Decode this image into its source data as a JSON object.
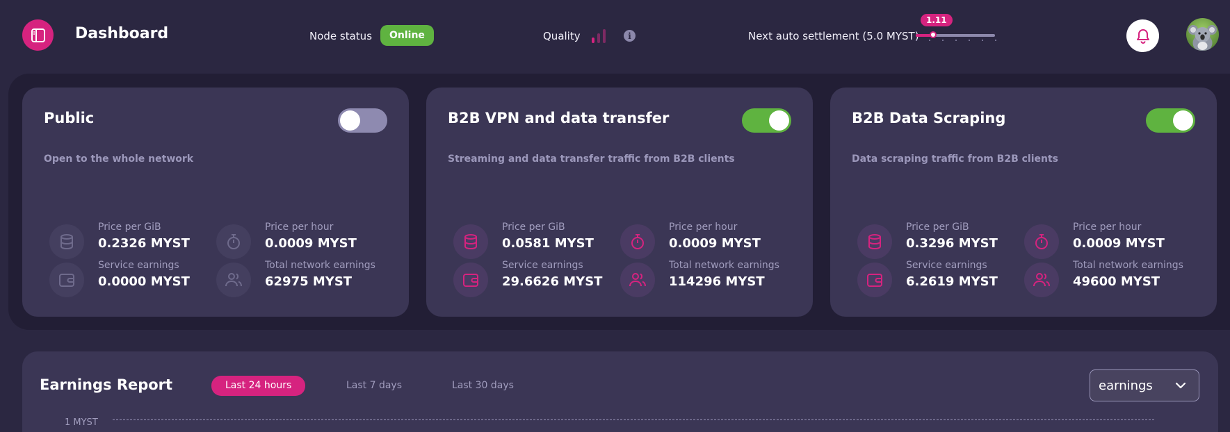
{
  "header": {
    "title": "Dashboard",
    "node_status_label": "Node status",
    "node_status_value": "Online",
    "quality_label": "Quality",
    "quality_bars_active": 1,
    "quality_bars_total": 3,
    "settlement_label": "Next auto settlement (5.0 MYST)",
    "settlement_value": "1.11",
    "settlement_fraction": 0.22,
    "icons": [
      "sidebar-toggle-icon",
      "quality-bars-icon",
      "info-icon",
      "bell-icon",
      "koala-avatar"
    ]
  },
  "services": [
    {
      "title": "Public",
      "description": "Open to the whole network",
      "enabled": false,
      "metrics": {
        "price_gib_label": "Price per GiB",
        "price_gib_value": "0.2326 MYST",
        "price_hour_label": "Price per hour",
        "price_hour_value": "0.0009 MYST",
        "service_earnings_label": "Service earnings",
        "service_earnings_value": "0.0000 MYST",
        "network_earnings_label": "Total network earnings",
        "network_earnings_value": "62975 MYST"
      }
    },
    {
      "title": "B2B VPN and data transfer",
      "description": "Streaming and data transfer traffic from B2B clients",
      "enabled": true,
      "metrics": {
        "price_gib_label": "Price per GiB",
        "price_gib_value": "0.0581 MYST",
        "price_hour_label": "Price per hour",
        "price_hour_value": "0.0009 MYST",
        "service_earnings_label": "Service earnings",
        "service_earnings_value": "29.6626 MYST",
        "network_earnings_label": "Total network earnings",
        "network_earnings_value": "114296 MYST"
      }
    },
    {
      "title": "B2B Data Scraping",
      "description": "Data scraping traffic from B2B clients",
      "enabled": true,
      "metrics": {
        "price_gib_label": "Price per GiB",
        "price_gib_value": "0.3296 MYST",
        "price_hour_label": "Price per hour",
        "price_hour_value": "0.0009 MYST",
        "service_earnings_label": "Service earnings",
        "service_earnings_value": "6.2619 MYST",
        "network_earnings_label": "Total network earnings",
        "network_earnings_value": "49600 MYST"
      }
    }
  ],
  "earnings": {
    "title": "Earnings Report",
    "tabs": [
      {
        "label": "Last 24 hours",
        "active": true
      },
      {
        "label": "Last 7 days",
        "active": false
      },
      {
        "label": "Last 30 days",
        "active": false
      }
    ],
    "select_value": "earnings",
    "y_tick": "1 MYST"
  },
  "colors": {
    "accent": "#d6237f",
    "online": "#5fb340",
    "background": "#2b2741",
    "card": "#3b3655",
    "icon_disabled": "#6f6b8c"
  }
}
